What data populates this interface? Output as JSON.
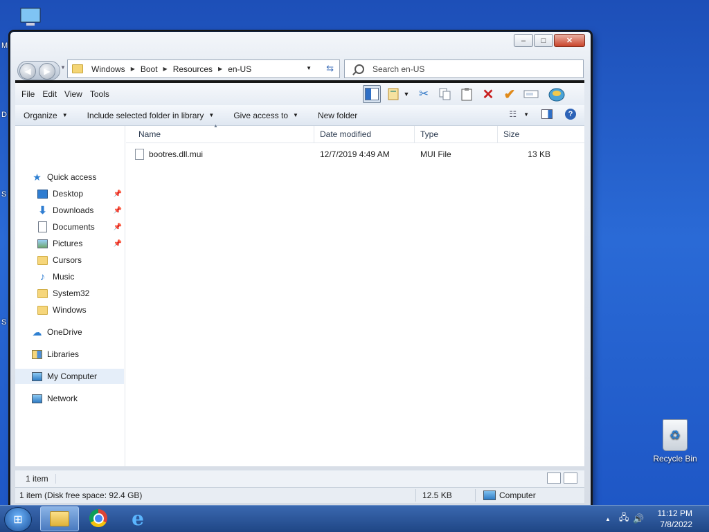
{
  "desktop": {
    "recycle_bin_label": "Recycle Bin",
    "left_edge_chars": [
      "M",
      "D",
      "S",
      "S"
    ]
  },
  "window": {
    "caption_buttons": {
      "minimize": "–",
      "maximize": "□",
      "close": "✕"
    },
    "breadcrumb": [
      "Windows",
      "Boot",
      "Resources",
      "en-US"
    ],
    "search_placeholder": "Search en-US",
    "menu": [
      "File",
      "Edit",
      "View",
      "Tools"
    ],
    "commands": {
      "organize": "Organize",
      "include_in_library": "Include selected folder in library",
      "give_access": "Give access to",
      "new_folder": "New folder"
    },
    "nav_pane": {
      "quick_access": "Quick access",
      "items": [
        {
          "label": "Desktop",
          "icon": "desktop-icon",
          "pinned": true
        },
        {
          "label": "Downloads",
          "icon": "downloads-icon",
          "pinned": true
        },
        {
          "label": "Documents",
          "icon": "documents-icon",
          "pinned": true
        },
        {
          "label": "Pictures",
          "icon": "pictures-icon",
          "pinned": true
        },
        {
          "label": "Cursors",
          "icon": "folder-icon",
          "pinned": false
        },
        {
          "label": "Music",
          "icon": "music-icon",
          "pinned": false
        },
        {
          "label": "System32",
          "icon": "folder-icon",
          "pinned": false
        },
        {
          "label": "Windows",
          "icon": "folder-icon",
          "pinned": false
        }
      ],
      "onedrive": "OneDrive",
      "libraries": "Libraries",
      "my_computer": "My Computer",
      "network": "Network"
    },
    "columns": [
      "Name",
      "Date modified",
      "Type",
      "Size"
    ],
    "files": [
      {
        "name": "bootres.dll.mui",
        "date": "12/7/2019 4:49 AM",
        "type": "MUI File",
        "size": "13 KB"
      }
    ],
    "details_bar": "1 item",
    "status": {
      "summary": "1 item (Disk free space: 92.4 GB)",
      "size": "12.5 KB",
      "location": "Computer"
    }
  },
  "taskbar": {
    "time": "11:12 PM",
    "date": "7/8/2022",
    "tray_arrow": "▲"
  },
  "colors": {
    "desktop": "#1d55c4",
    "taskbar": "#2a569b",
    "close_button": "#c9432a"
  }
}
